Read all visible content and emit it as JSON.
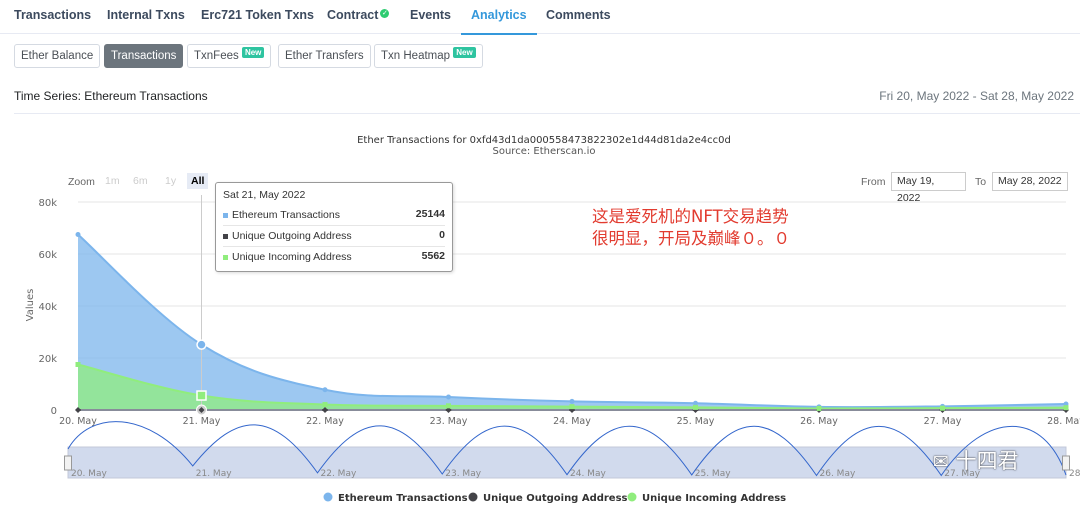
{
  "tabs": [
    {
      "label": "Transactions"
    },
    {
      "label": "Internal Txns"
    },
    {
      "label": "Erc721 Token Txns"
    },
    {
      "label": "Contract"
    },
    {
      "label": "Events"
    },
    {
      "label": "Analytics"
    },
    {
      "label": "Comments"
    }
  ],
  "active_tab": "Analytics",
  "subtabs": [
    {
      "label": "Ether Balance"
    },
    {
      "label": "Transactions"
    },
    {
      "label": "TxnFees",
      "badge": "New"
    },
    {
      "label": "Ether Transfers"
    },
    {
      "label": "Txn Heatmap",
      "badge": "New"
    }
  ],
  "active_subtab": "Transactions",
  "series_title": "Time Series: Ethereum Transactions",
  "date_range": "Fri 20, May 2022 - Sat 28, May 2022",
  "chart": {
    "title": "Ether Transactions for 0xfd43d1da000558473822302e1d44d81da2e4cc0d",
    "subtitle": "Source: Etherscan.io",
    "zoom_label": "Zoom",
    "zoom_buttons": [
      "1m",
      "6m",
      "1y",
      "All"
    ],
    "from_label": "From",
    "from_value": "May 19, 2022",
    "to_label": "To",
    "to_value": "May 28, 2022"
  },
  "chart_data": {
    "type": "area",
    "ylabel": "Values",
    "ylim": [
      0,
      80000
    ],
    "yticks": [
      "0",
      "20k",
      "40k",
      "60k",
      "80k"
    ],
    "categories": [
      "20. May",
      "21. May",
      "22. May",
      "23. May",
      "24. May",
      "25. May",
      "26. May",
      "27. May",
      "28. May"
    ],
    "series": [
      {
        "name": "Ethereum Transactions",
        "color": "#7cb5ec",
        "values": [
          67500,
          25144,
          7800,
          5000,
          3300,
          2600,
          1200,
          1400,
          2300
        ]
      },
      {
        "name": "Unique Outgoing Address",
        "color": "#434348",
        "values": [
          0,
          0,
          0,
          0,
          0,
          0,
          0,
          0,
          0
        ]
      },
      {
        "name": "Unique Incoming Address",
        "color": "#90ed7d",
        "values": [
          17500,
          5562,
          2100,
          1600,
          1300,
          1000,
          600,
          700,
          900
        ]
      }
    ],
    "grid": true,
    "legend": "bottom-center"
  },
  "tooltip": {
    "date": "Sat 21, May 2022",
    "rows": [
      {
        "name": "Ethereum Transactions",
        "value": "25144",
        "color": "#7cb5ec"
      },
      {
        "name": "Unique Outgoing Address",
        "value": "0",
        "color": "#434348"
      },
      {
        "name": "Unique Incoming Address",
        "value": "5562",
        "color": "#90ed7d"
      }
    ]
  },
  "annotation": {
    "line1": "这是爱死机的NFT交易趋势",
    "line2": "很明显，开局及巅峰０。０"
  },
  "watermark": "十四君"
}
